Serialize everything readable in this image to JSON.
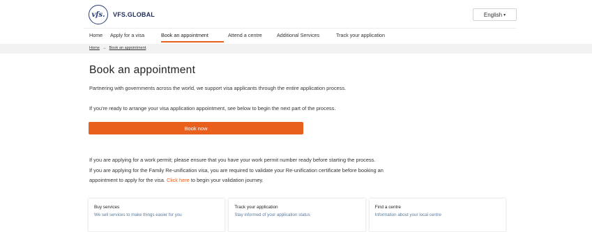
{
  "header": {
    "logo_mark": "vfs.",
    "brand": "VFS.GLOBAL",
    "language": "English",
    "language_caret": "▾"
  },
  "nav": {
    "items": [
      {
        "label": "Home"
      },
      {
        "label": "Apply for a visa"
      },
      {
        "label": "Book an appointment"
      },
      {
        "label": "Attend a centre"
      },
      {
        "label": "Additional Services"
      },
      {
        "label": "Track your application"
      }
    ],
    "active_index": 2
  },
  "breadcrumb": {
    "home": "Home",
    "separator": "→",
    "current": "Book an appointment"
  },
  "main": {
    "title": "Book an appointment",
    "intro": "Partnering with governments across the world, we support visa applicants through the entire application process.",
    "ready": "If you're ready to arrange your visa application appointment, see below to begin the next part of the process.",
    "book_now": "Book now",
    "work_permit": "If you are applying for a work permit; please ensure that you have your work permit number ready before starting the process.",
    "family_1": "If you are applying for the Family Re-unification visa, you are required to validate your Re-unification certificate before booking an",
    "family_2_pre": "appointment to apply for the visa.",
    "family_link": "Click here",
    "family_2_post": "to begin your validation journey."
  },
  "cards": [
    {
      "title": "Buy services",
      "desc": "We sell services to make things easier for you"
    },
    {
      "title": "Track your application",
      "desc": "Stay informed of your application status"
    },
    {
      "title": "Find a centre",
      "desc": "Information about your local centre"
    }
  ],
  "colors": {
    "accent": "#e8601c",
    "brand_navy": "#1d2b5a",
    "card_desc": "#5a7a9a"
  }
}
